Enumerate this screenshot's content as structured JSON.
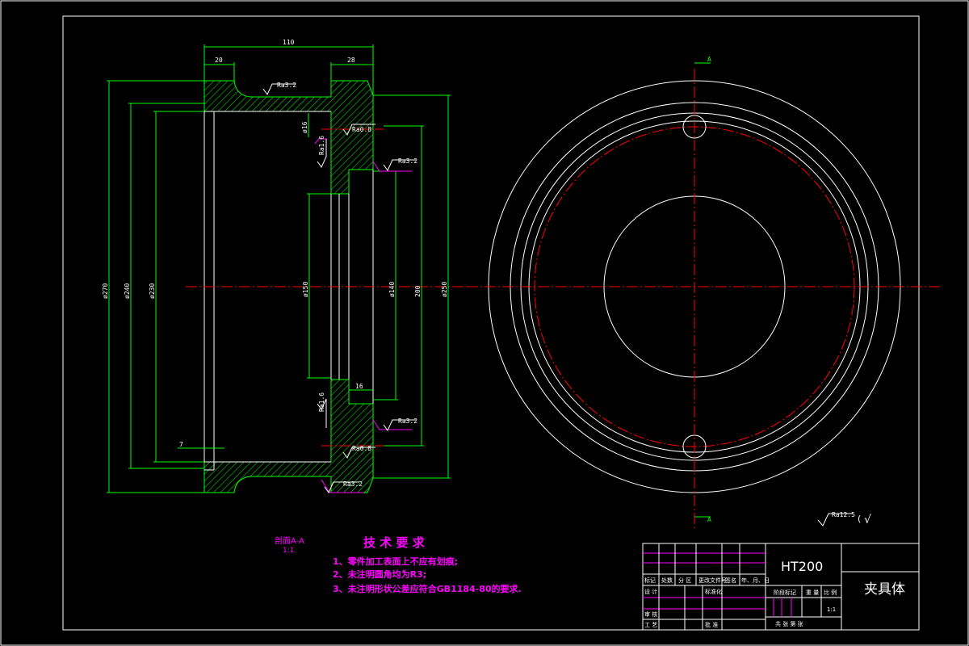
{
  "dimensions": {
    "overall_length": "110",
    "left_flange": "20",
    "right_flange": "28",
    "step_depth": "16",
    "offset": "7",
    "phi270": "ø270",
    "phi240": "ø240",
    "phi230": "ø230",
    "phi150": "ø150",
    "phi140": "ø140",
    "phi250": "ø250",
    "dim200": "200",
    "phi16": "ø16"
  },
  "roughness": {
    "ra32_top": "Ra3.2",
    "ra08_top": "Ra0.8",
    "ra16_top": "Ra1.6",
    "ra32_mid_top": "Ra3.2",
    "ra16_bottom": "Ra1.6",
    "ra32_mid_bottom": "Ra3.2",
    "ra08_bottom": "Ra0.8",
    "ra32_bottom": "Ra3.2",
    "ra125_global": "Ra12.5",
    "ra_global_paren": "(",
    "ra_global_check": "√"
  },
  "section": {
    "top_label": "A",
    "bottom_label": "A",
    "view_label": "剖面A-A",
    "view_scale": "1:1"
  },
  "tech_requirements": {
    "title": "技 术 要 求",
    "items": [
      "1、零件加工表面上不应有划痕;",
      "2、未注明圆角均为R3;",
      "3、未注明形状公差应符合GB1184-80的要求."
    ]
  },
  "title_block": {
    "material": "HT200",
    "part_name": "夹具体",
    "header_row": [
      "标记",
      "处数",
      "分 区",
      "更改文件号",
      "签名",
      "年、月、日"
    ],
    "designer_label": "设 计",
    "standardization_label": "标准化",
    "stage_label": "阶段标记",
    "weight_label": "重 量",
    "scale_label": "比 例",
    "scale_value": "1:1",
    "checker_label": "审 核",
    "process_label": "工 艺",
    "approve_label": "批 准",
    "sheets_text": "共  张  第  张"
  },
  "colors": {
    "background": "#000000",
    "outline": "#ffffff",
    "dimension": "#00ff00",
    "centerline": "#ff0000",
    "annotation": "#ff00ff"
  }
}
